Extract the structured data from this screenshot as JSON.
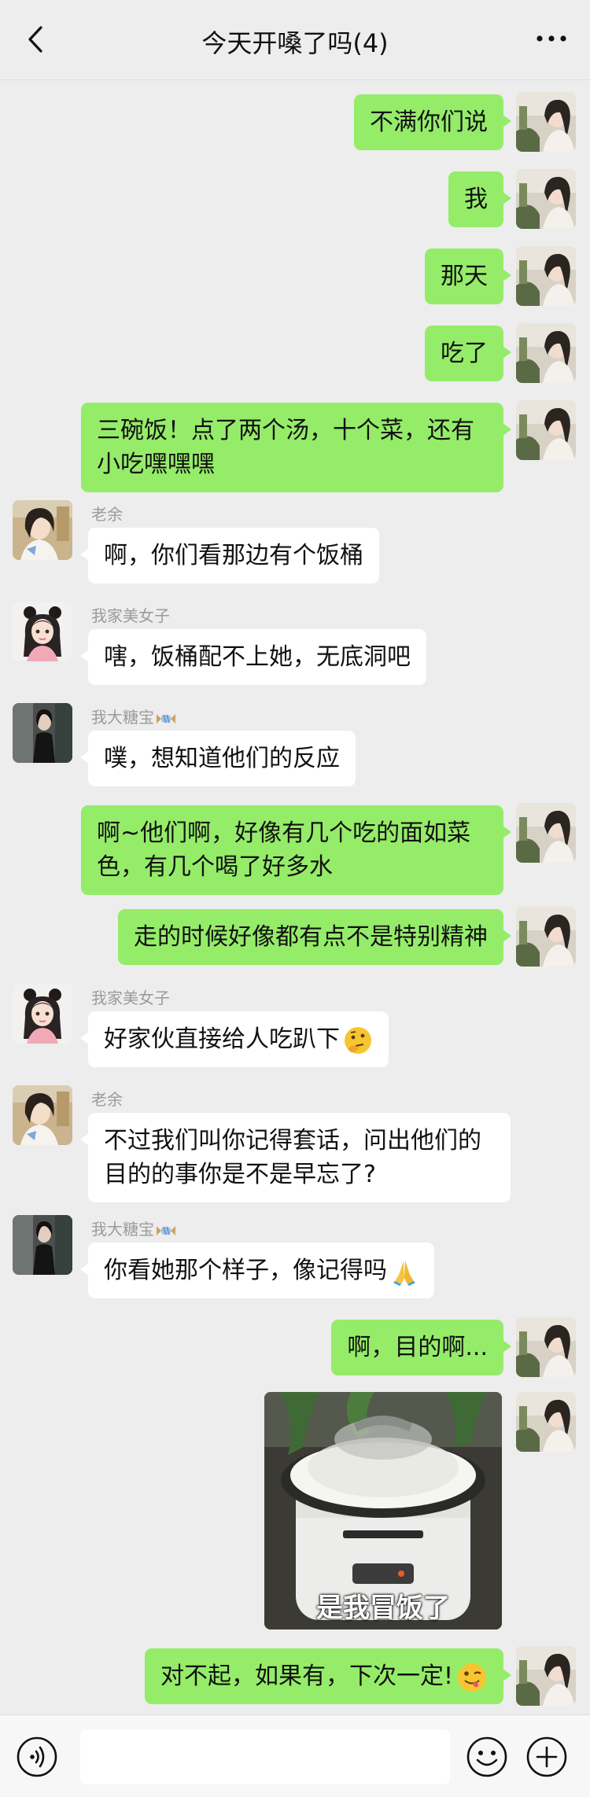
{
  "header": {
    "title": "今天开嗓了吗(4)",
    "back_icon": "chevron-left-icon",
    "more_icon": "more-dots-icon"
  },
  "messages": [
    {
      "side": "me",
      "text": "不满你们说"
    },
    {
      "side": "me",
      "text": "我"
    },
    {
      "side": "me",
      "text": "那天"
    },
    {
      "side": "me",
      "text": "吃了"
    },
    {
      "side": "me",
      "text": "三碗饭！点了两个汤，十个菜，还有小吃嘿嘿嘿"
    },
    {
      "side": "them",
      "sender": "老余",
      "text": "啊，你们看那边有个饭桶"
    },
    {
      "side": "them",
      "sender": "我家美女子",
      "text": "嗐，饭桶配不上她，无底洞吧"
    },
    {
      "side": "them",
      "sender": "我大糖宝",
      "sender_badge": "candy-icon",
      "text": "噗，想知道他们的反应"
    },
    {
      "side": "me",
      "text": "啊~他们啊，好像有几个吃的面如菜色，有几个喝了好多水"
    },
    {
      "side": "me",
      "text": "走的时候好像都有点不是特别精神"
    },
    {
      "side": "them",
      "sender": "我家美女子",
      "text": "好家伙直接给人吃趴下",
      "emoji": "thinking-face-icon"
    },
    {
      "side": "them",
      "sender": "老余",
      "text": "不过我们叫你记得套话，问出他们的目的的事你是不是早忘了?"
    },
    {
      "side": "them",
      "sender": "我大糖宝",
      "sender_badge": "candy-icon",
      "text": "你看她那个样子，像记得吗",
      "emoji": "folded-hands-icon"
    },
    {
      "side": "me",
      "text": "啊，目的啊..."
    },
    {
      "side": "me",
      "type": "sticker",
      "caption": "是我冒饭了",
      "image": "rice-cooker-sticker"
    },
    {
      "side": "me",
      "text": "对不起，如果有，下次一定!",
      "emoji": "winking-face-tongue-icon"
    }
  ],
  "input_bar": {
    "voice_icon": "voice-icon",
    "emoji_icon": "smiley-icon",
    "plus_icon": "plus-circle-icon",
    "input_value": ""
  },
  "colors": {
    "background": "#ededed",
    "my_bubble": "#95ec69",
    "their_bubble": "#ffffff"
  }
}
